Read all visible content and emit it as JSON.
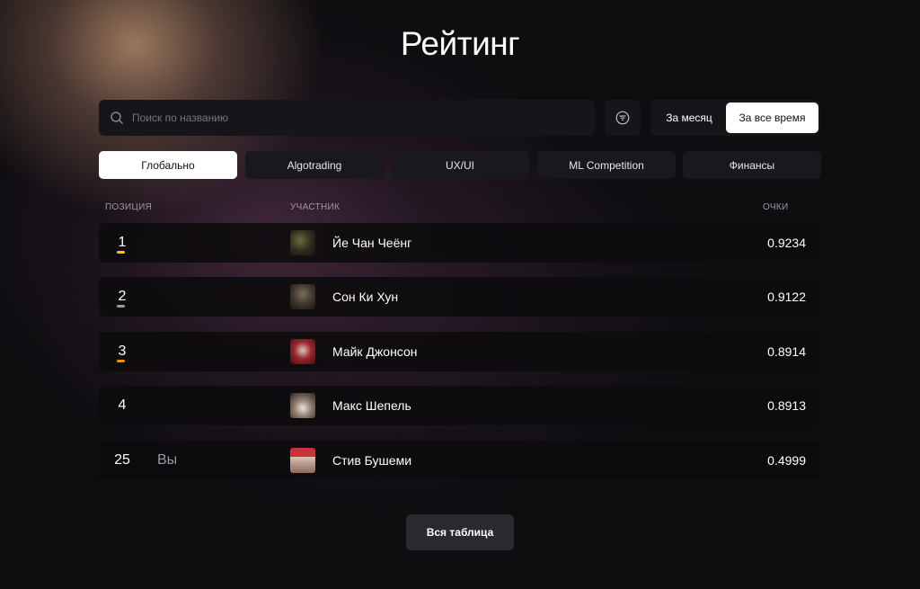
{
  "page": {
    "title": "Рейтинг"
  },
  "search": {
    "placeholder": "Поиск по названию",
    "value": ""
  },
  "period": {
    "options": [
      "За месяц",
      "За все время"
    ],
    "selected": "За все время"
  },
  "tabs": [
    {
      "label": "Глобально",
      "active": true
    },
    {
      "label": "Algotrading",
      "active": false
    },
    {
      "label": "UX/UI",
      "active": false
    },
    {
      "label": "ML Competition",
      "active": false
    },
    {
      "label": "Финансы",
      "active": false
    }
  ],
  "table": {
    "headers": {
      "position": "ПОЗИЦИЯ",
      "participant": "УЧАСТНИК",
      "points": "ОЧКИ"
    },
    "rows": [
      {
        "position": "1",
        "name": "Йе Чан Чеёнг",
        "score": "0.9234",
        "marker_color": "#f5c518",
        "avatar": "avatar-photo"
      },
      {
        "position": "2",
        "name": "Сон Ки Хун",
        "score": "0.9122",
        "marker_color": "#9a9a9a",
        "avatar": "avatar-photo"
      },
      {
        "position": "3",
        "name": "Майк Джонсон",
        "score": "0.8914",
        "marker_color": "#e8920f",
        "avatar": "avatar-photo"
      },
      {
        "position": "4",
        "name": "Макс Шепель",
        "score": "0.8913",
        "avatar": "avatar-photo"
      },
      {
        "position": "25",
        "you_label": "Вы",
        "name": "Стив Бушеми",
        "score": "0.4999",
        "avatar": "avatar-photo"
      }
    ]
  },
  "footer": {
    "all_table_label": "Вся таблица"
  },
  "icons": {
    "search": "search-icon",
    "filter": "filter-icon"
  },
  "colors": {
    "background": "#0e0d10",
    "panel": "#16151a",
    "active": "#ffffff"
  }
}
